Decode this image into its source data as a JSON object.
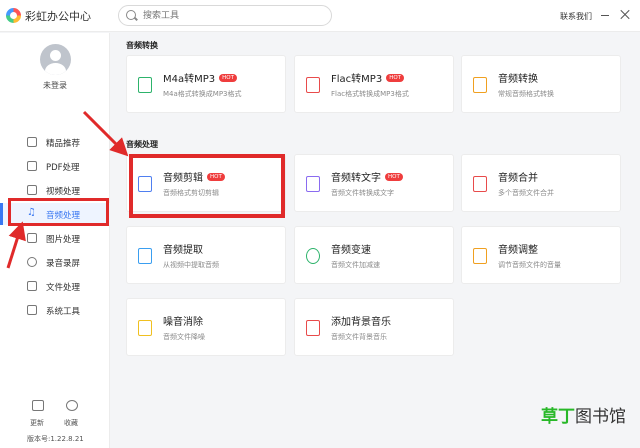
{
  "app": {
    "title": "彩虹办公中心",
    "contact": "联系我们"
  },
  "search": {
    "placeholder": "搜索工具"
  },
  "user": {
    "login_label": "未登录"
  },
  "sidebar": {
    "items": [
      {
        "label": "精品推荐",
        "icon": "thumbs-up-icon"
      },
      {
        "label": "PDF处理",
        "icon": "pdf-icon"
      },
      {
        "label": "视频处理",
        "icon": "video-icon"
      },
      {
        "label": "音频处理",
        "icon": "music-note-icon",
        "active": true
      },
      {
        "label": "图片处理",
        "icon": "image-icon"
      },
      {
        "label": "录音录屏",
        "icon": "record-icon"
      },
      {
        "label": "文件处理",
        "icon": "folder-icon"
      },
      {
        "label": "系统工具",
        "icon": "monitor-icon"
      }
    ],
    "footer": {
      "update_label": "更新",
      "favorite_label": "收藏",
      "version": "版本号:1.22.8.21"
    }
  },
  "sections": [
    {
      "title": "音频转换",
      "cards": [
        {
          "title": "M4a转MP3",
          "hot": "HOT",
          "subtitle": "M4a格式转换成MP3格式",
          "icon": "m4a-mp3-icon",
          "color": "#2db36b"
        },
        {
          "title": "Flac转MP3",
          "hot": "HOT",
          "subtitle": "Flac格式转换成MP3格式",
          "icon": "flac-mp3-icon",
          "color": "#e84b4b"
        },
        {
          "title": "音频转换",
          "subtitle": "常规音频格式转换",
          "icon": "audio-convert-icon",
          "color": "#f0a020"
        }
      ]
    },
    {
      "title": "音频处理",
      "cards": [
        {
          "title": "音频剪辑",
          "hot": "HOT",
          "subtitle": "音频格式剪切剪辑",
          "icon": "audio-cut-icon",
          "color": "#4f7ff0"
        },
        {
          "title": "音频转文字",
          "hot": "HOT",
          "subtitle": "音频文件转换成文字",
          "icon": "audio-text-icon",
          "color": "#8a6bf0"
        },
        {
          "title": "音频合并",
          "subtitle": "多个音频文件合并",
          "icon": "audio-merge-icon",
          "color": "#e84b4b"
        },
        {
          "title": "音频提取",
          "subtitle": "从视频中提取音频",
          "icon": "audio-extract-icon",
          "color": "#3a9ef0"
        },
        {
          "title": "音频变速",
          "subtitle": "音频文件加减速",
          "icon": "audio-speed-icon",
          "color": "#2db36b"
        },
        {
          "title": "音频调整",
          "subtitle": "调节音频文件的音量",
          "icon": "volume-icon",
          "color": "#f0a020"
        },
        {
          "title": "噪音消除",
          "subtitle": "音频文件降噪",
          "icon": "noise-remove-icon",
          "color": "#f0c020"
        },
        {
          "title": "添加背景音乐",
          "subtitle": "音频文件背景音乐",
          "icon": "bg-music-icon",
          "color": "#e84b4b"
        }
      ]
    }
  ],
  "watermark": {
    "green": "草丁",
    "dark": "图书馆"
  }
}
